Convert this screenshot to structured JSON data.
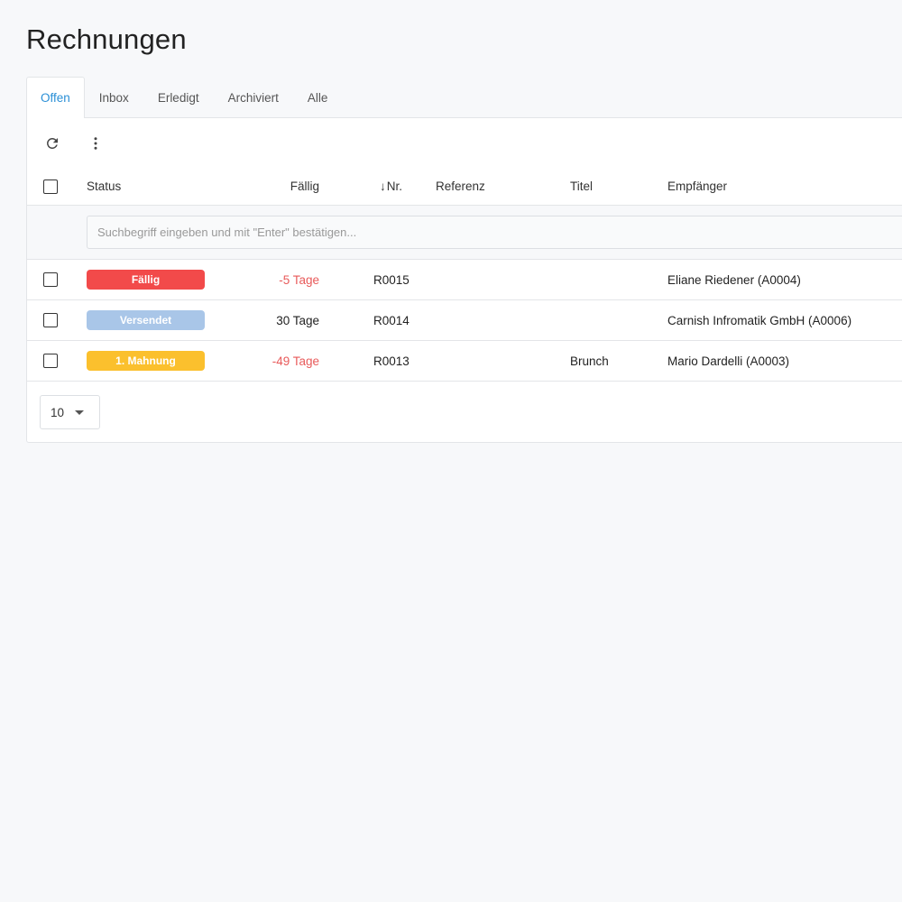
{
  "page": {
    "title": "Rechnungen"
  },
  "tabs": [
    {
      "label": "Offen",
      "active": true
    },
    {
      "label": "Inbox",
      "active": false
    },
    {
      "label": "Erledigt",
      "active": false
    },
    {
      "label": "Archiviert",
      "active": false
    },
    {
      "label": "Alle",
      "active": false
    }
  ],
  "toolbar": {
    "refresh_icon": "refresh-icon",
    "more_icon": "more-vertical-icon"
  },
  "table": {
    "columns": {
      "status": "Status",
      "faellig": "Fällig",
      "nr_arrow": "↓",
      "nr": "Nr.",
      "referenz": "Referenz",
      "titel": "Titel",
      "empfaenger": "Empfänger"
    },
    "search_placeholder": "Suchbegriff eingeben und mit \"Enter\" bestätigen...",
    "rows": [
      {
        "status": "Fällig",
        "status_color": "#f24a4a",
        "faellig": "-5 Tage",
        "faellig_negative": true,
        "nr": "R0015",
        "referenz": "",
        "titel": "",
        "empfaenger": "Eliane Riedener (A0004)"
      },
      {
        "status": "Versendet",
        "status_color": "#a9c6e8",
        "faellig": "30 Tage",
        "faellig_negative": false,
        "nr": "R0014",
        "referenz": "",
        "titel": "",
        "empfaenger": "Carnish Infromatik GmbH (A0006)"
      },
      {
        "status": "1. Mahnung",
        "status_color": "#fbc02d",
        "faellig": "-49 Tage",
        "faellig_negative": true,
        "nr": "R0013",
        "referenz": "",
        "titel": "Brunch",
        "empfaenger": "Mario Dardelli (A0003)"
      }
    ]
  },
  "pagination": {
    "page_size": "10"
  }
}
